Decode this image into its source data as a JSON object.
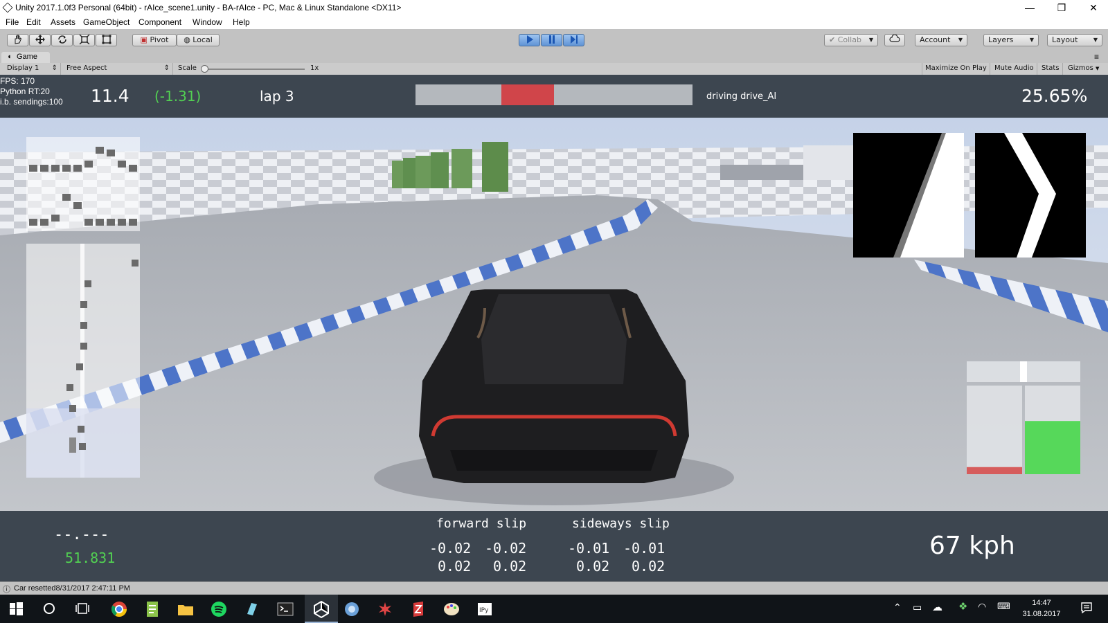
{
  "window": {
    "title": "Unity 2017.1.0f3 Personal (64bit) - rAIce_scene1.unity - BA-rAIce - PC, Mac & Linux Standalone <DX11>",
    "controls": {
      "minimize": "—",
      "maximize": "❐",
      "close": "✕"
    }
  },
  "menu": [
    "File",
    "Edit",
    "Assets",
    "GameObject",
    "Component",
    "Window",
    "Help"
  ],
  "toolbar": {
    "tools": [
      "hand-icon",
      "move-icon",
      "rotate-icon",
      "scale-icon",
      "rect-icon"
    ],
    "pivot": "Pivot",
    "local": "Local",
    "collab": "Collab",
    "account": "Account",
    "layers": "Layers",
    "layout": "Layout"
  },
  "game_panel": {
    "tab": "Game",
    "display": "Display 1",
    "aspect": "Free Aspect",
    "scale_label": "Scale",
    "scale_value": "1x",
    "options": [
      "Maximize On Play",
      "Mute Audio",
      "Stats",
      "Gizmos"
    ]
  },
  "hud_top": {
    "fps": "FPS: 170",
    "python_rt": "Python RT:20",
    "sendings": "i.b. sendings:100",
    "laptime": "11.4",
    "delta": "(-1.31)",
    "lap": "lap 3",
    "mode": "driving drive_AI",
    "progress_pct": "25.65%",
    "progress_bar": {
      "marker_start": 0.31,
      "marker_end": 0.5
    }
  },
  "hud_bottom": {
    "last_time": "--.---",
    "best_time": "51.831",
    "forward_slip_label": "forward slip",
    "forward_slip": [
      "-0.02",
      "-0.02",
      "0.02",
      "0.02"
    ],
    "sideways_slip_label": "sideways slip",
    "sideways_slip": [
      "-0.01",
      "-0.01",
      "0.02",
      "0.02"
    ],
    "speed": "67 kph"
  },
  "gauges": {
    "steering": 0.5,
    "brake": 0.08,
    "throttle": 0.6
  },
  "colors": {
    "hud_bg": "#3d4650",
    "delta_green": "#52d052",
    "progress_red": "#d0454a",
    "throttle_green": "#56d85a",
    "brake_red": "#d65c5c",
    "kerb_blue": "#4d74c8"
  },
  "status": "Car resetted8/31/2017 2:47:11 PM",
  "taskbar": {
    "time": "14:47",
    "date": "31.08.2017"
  }
}
